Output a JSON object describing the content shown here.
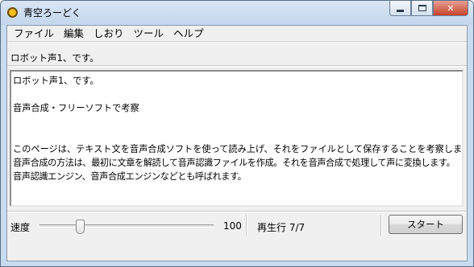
{
  "window": {
    "title": "青空ろーどく"
  },
  "menu": [
    "ファイル",
    "編集",
    "しおり",
    "ツール",
    "ヘルプ"
  ],
  "current_sentence": "ロボット声1、です。",
  "document_lines": [
    "ロボット声1、です。",
    "",
    "音声合成・フリーソフトで考察",
    "",
    "",
    "このページは、テキスト文を音声合成ソフトを使って読み上げ、それをファイルとして保存することを考察します。",
    "音声合成の方法は、最初に文章を解読して音声認識ファイルを作成。それを音声合成で処理して声に変換します。音声認識エンジン、音声合成エンジンなどとも呼ばれます。"
  ],
  "controls": {
    "speed_label": "速度",
    "speed_value": "100",
    "speed_level_fraction": 0.22,
    "status": "再生行 7/7",
    "start_label": "スタート"
  },
  "caption_buttons": [
    "minimize-icon",
    "maximize-icon",
    "close-icon"
  ]
}
